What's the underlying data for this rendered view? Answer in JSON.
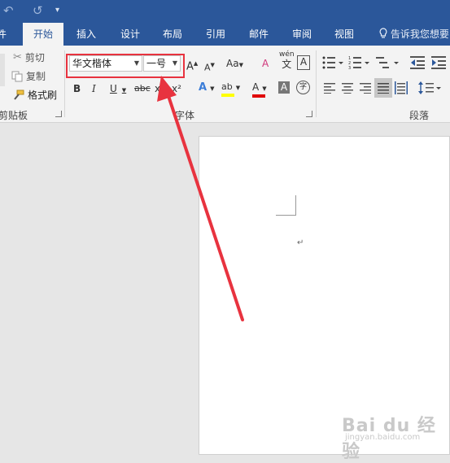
{
  "quick_access": {
    "undo_icon": "↶",
    "redo_icon": "↺",
    "customize_icon": "▾"
  },
  "tabs": [
    {
      "label": "件"
    },
    {
      "label": "开始"
    },
    {
      "label": "插入"
    },
    {
      "label": "设计"
    },
    {
      "label": "布局"
    },
    {
      "label": "引用"
    },
    {
      "label": "邮件"
    },
    {
      "label": "审阅"
    },
    {
      "label": "视图"
    }
  ],
  "tell_me": {
    "label": "告诉我您想要",
    "icon": "lightbulb-icon"
  },
  "clipboard": {
    "cut": "剪切",
    "copy": "复制",
    "format_painter": "格式刷",
    "group_label": "剪贴板"
  },
  "font": {
    "family": "华文楷体",
    "size": "一号",
    "grow": "A",
    "shrink": "A",
    "change_case": "Aa",
    "clear_format": "A",
    "phonetic_top": "wén",
    "phonetic_bottom": "文",
    "char_border": "A",
    "bold": "B",
    "italic": "I",
    "underline": "U",
    "strikethrough": "abc",
    "subscript": "x",
    "superscript": "x²",
    "text_effects": "A",
    "highlight": "ab",
    "font_color": "A",
    "char_shading": "A",
    "enclose": "字",
    "group_label": "字体"
  },
  "paragraph": {
    "group_label": "段落"
  },
  "document": {
    "paragraph_mark": "↵"
  },
  "watermark": {
    "brand": "Bai du 经验",
    "url": "jingyan.baidu.com"
  },
  "colors": {
    "accent": "#2b579a",
    "annotation": "#e8333f",
    "highlight": "#ffff00",
    "font_color": "#e00000"
  }
}
